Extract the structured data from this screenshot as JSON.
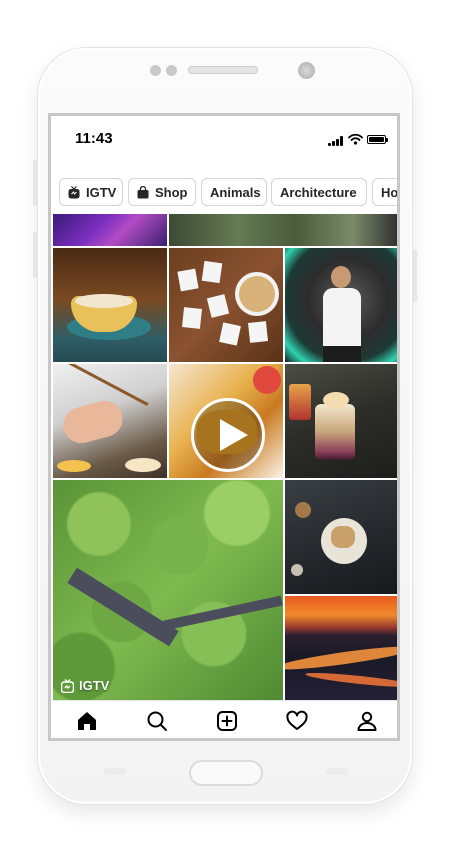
{
  "status_bar": {
    "time": "11:43"
  },
  "chips": [
    {
      "label": "IGTV",
      "icon": "igtv-icon"
    },
    {
      "label": "Shop",
      "icon": "shopping-bag-icon"
    },
    {
      "label": "Animals"
    },
    {
      "label": "Architecture"
    },
    {
      "label": "Ho"
    }
  ],
  "grid": {
    "video_play_icon": "play-icon",
    "igtv_badge": {
      "label": "IGTV",
      "icon": "igtv-icon"
    }
  },
  "tabbar": {
    "items": [
      {
        "name": "home",
        "icon": "home-icon",
        "active": true
      },
      {
        "name": "search",
        "icon": "search-icon"
      },
      {
        "name": "new-post",
        "icon": "plus-square-icon"
      },
      {
        "name": "activity",
        "icon": "heart-icon"
      },
      {
        "name": "profile",
        "icon": "profile-icon"
      }
    ]
  },
  "colors": {
    "text": "#262626",
    "chip_border": "#d4d4d4",
    "screen_bg": "#ffffff"
  }
}
